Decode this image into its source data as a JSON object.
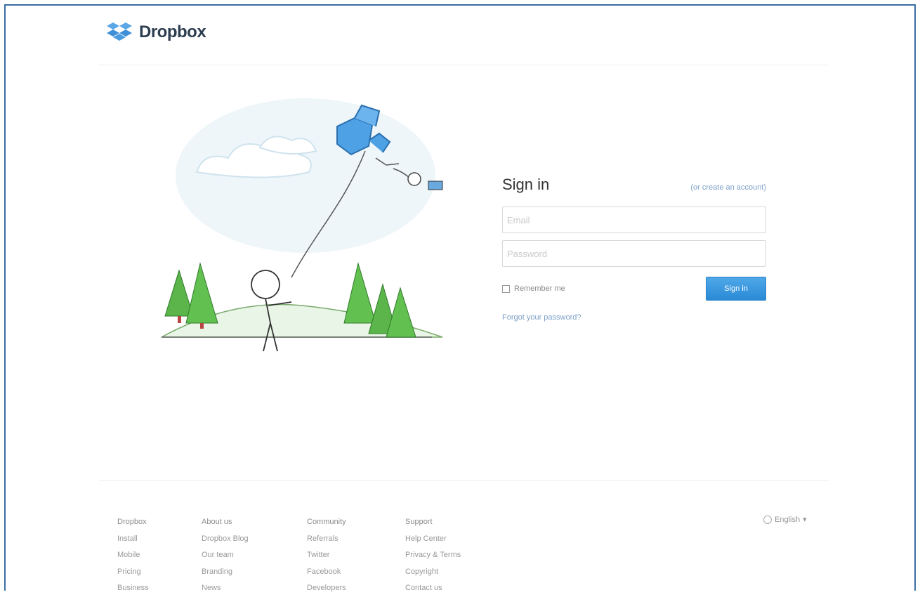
{
  "header": {
    "brand": "Dropbox",
    "logo_icon": "dropbox-box-icon"
  },
  "illustration": {
    "icon": "kite-stickman-illustration"
  },
  "signin": {
    "title": "Sign in",
    "create_link": "(or create an account)",
    "email_placeholder": "Email",
    "password_placeholder": "Password",
    "remember_label": "Remember me",
    "submit_label": "Sign in",
    "forgot_link": "Forgot your password?"
  },
  "footer": {
    "columns": [
      {
        "head": "Dropbox",
        "links": [
          "Install",
          "Mobile",
          "Pricing",
          "Business"
        ]
      },
      {
        "head": "About us",
        "links": [
          "Dropbox Blog",
          "Our team",
          "Branding",
          "News"
        ]
      },
      {
        "head": "Community",
        "links": [
          "Referrals",
          "Twitter",
          "Facebook",
          "Developers"
        ]
      },
      {
        "head": "Support",
        "links": [
          "Help Center",
          "Privacy & Terms",
          "Copyright",
          "Contact us"
        ]
      }
    ],
    "language": "English",
    "language_caret": "▾"
  },
  "colors": {
    "accent": "#2a8ad6",
    "link": "#7d9fc8",
    "frame": "#3b6ea8"
  }
}
